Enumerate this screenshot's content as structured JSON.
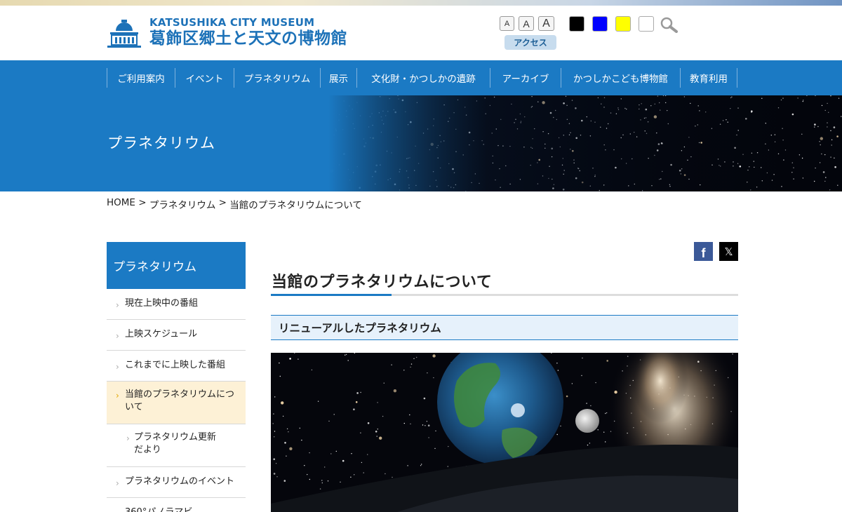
{
  "header": {
    "logo_en": "KATSUSHIKA CITY MUSEUM",
    "logo_ja": "葛飾区郷土と天文の博物館",
    "font_size_buttons": [
      "A",
      "A",
      "A"
    ],
    "access_label": "アクセス",
    "color_swatches": [
      "#000000",
      "#0000ff",
      "#ffff00",
      "#ffffff"
    ]
  },
  "nav": [
    "ご利用案内",
    "イベント",
    "プラネタリウム",
    "展示",
    "文化財・かつしかの遺跡",
    "アーカイブ",
    "かつしかこども博物館",
    "教育利用"
  ],
  "hero": {
    "title": "プラネタリウム"
  },
  "breadcrumb": [
    "HOME",
    " > ",
    "プラネタリウム",
    " > ",
    "当館のプラネタリウムについて"
  ],
  "sidebar": {
    "heading": "プラネタリウム",
    "items": [
      {
        "label": "現在上映中の番組"
      },
      {
        "label": "上映スケジュール"
      },
      {
        "label": "これまでに上映した番組"
      },
      {
        "label": "当館のプラネタリウムについて",
        "active": true
      },
      {
        "label": "プラネタリウム更新だより",
        "sub": true
      },
      {
        "label": "プラネタリウムのイベント"
      },
      {
        "label": "360°パノラマビ"
      }
    ]
  },
  "main": {
    "title": "当館のプラネタリウムについて",
    "section_heading": "リニューアルしたプラネタリウム",
    "share": [
      "facebook-icon",
      "x-icon"
    ]
  },
  "colors": {
    "brand": "#1b7ac4",
    "active_bg": "#fdf1d6"
  }
}
